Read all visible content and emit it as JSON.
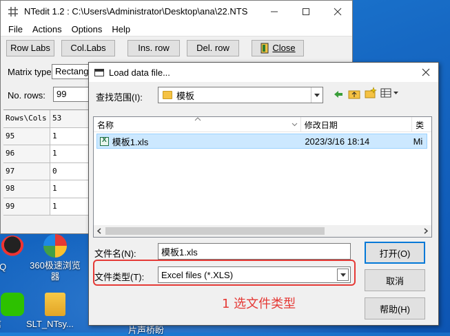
{
  "desktop": {
    "icons": [
      {
        "label": "讯QQ",
        "icon": "qq-icon"
      },
      {
        "label": "360极速浏览器",
        "icon": "360-browser-icon"
      },
      {
        "label": "微信",
        "icon": "wechat-icon"
      },
      {
        "label": "SLT_NTsy...",
        "icon": "folder-zip-icon"
      }
    ],
    "partial_label": "片声桥盼"
  },
  "ntedit": {
    "title": "NTedit 1.2 : C:\\Users\\Administrator\\Desktop\\ana\\22.NTS",
    "menu": [
      "File",
      "Actions",
      "Options",
      "Help"
    ],
    "toolbar": {
      "row_labs": "Row Labs",
      "col_labs": "Col.Labs",
      "ins_row": "Ins. row",
      "del_row": "Del. row",
      "close": "Close"
    },
    "matrix_type_label": "Matrix type:",
    "matrix_type_value": "Rectang",
    "no_rows_label": "No. rows:",
    "no_rows_value": "99",
    "grid": {
      "header": [
        "Rows\\Cols",
        "53"
      ],
      "rows": [
        [
          "95",
          "1"
        ],
        [
          "96",
          "1"
        ],
        [
          "97",
          "0"
        ],
        [
          "98",
          "1"
        ],
        [
          "99",
          "1"
        ]
      ]
    }
  },
  "dialog": {
    "title": "Load data file...",
    "look_in_label": "查找范围(I):",
    "look_in_value": "模板",
    "columns": [
      "名称",
      "修改日期",
      "类"
    ],
    "files": [
      {
        "name": "模板1.xls",
        "modified": "2023/3/16 18:14",
        "type": "Mi"
      }
    ],
    "filename_label": "文件名(N):",
    "filename_value": "模板1.xls",
    "filetype_label": "文件类型(T):",
    "filetype_value": "Excel files (*.XLS)",
    "open_button": "打开(O)",
    "cancel_button": "取消",
    "help_button": "帮助(H)"
  },
  "annotation": {
    "text": "1 选文件类型",
    "color": "#e53935"
  }
}
